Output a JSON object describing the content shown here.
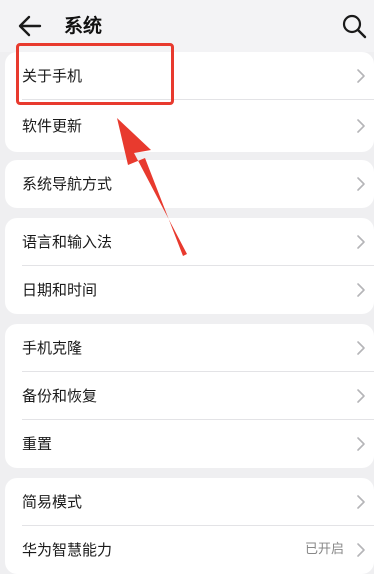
{
  "header": {
    "title": "系统"
  },
  "groups": [
    {
      "items": [
        {
          "label": "关于手机"
        },
        {
          "label": "软件更新"
        }
      ]
    },
    {
      "items": [
        {
          "label": "系统导航方式"
        }
      ]
    },
    {
      "items": [
        {
          "label": "语言和输入法"
        },
        {
          "label": "日期和时间"
        }
      ]
    },
    {
      "items": [
        {
          "label": "手机克隆"
        },
        {
          "label": "备份和恢复"
        },
        {
          "label": "重置"
        }
      ]
    },
    {
      "items": [
        {
          "label": "简易模式"
        },
        {
          "label": "华为智慧能力",
          "value": "已开启"
        }
      ]
    }
  ],
  "colors": {
    "annotation": "#e83a2e",
    "background": "#efeff1",
    "card": "#ffffff",
    "chevron": "#b5b5b8"
  },
  "icons": {
    "back": "arrow-left-icon",
    "search": "search-icon",
    "chevron": "chevron-right-icon"
  }
}
